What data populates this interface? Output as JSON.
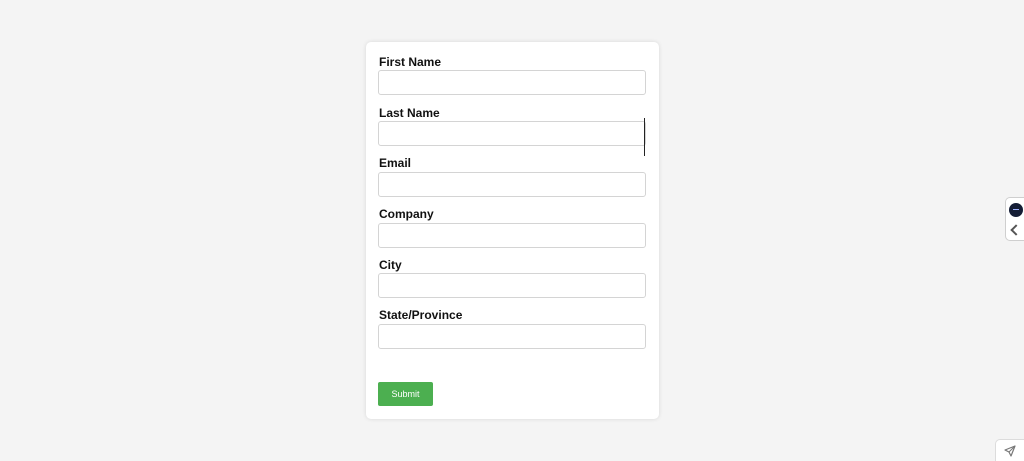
{
  "form": {
    "fields": [
      {
        "label": "First Name",
        "value": ""
      },
      {
        "label": "Last Name",
        "value": ""
      },
      {
        "label": "Email",
        "value": ""
      },
      {
        "label": "Company",
        "value": ""
      },
      {
        "label": "City",
        "value": ""
      },
      {
        "label": "State/Province",
        "value": ""
      }
    ],
    "submit_label": "Submit"
  },
  "colors": {
    "page_background": "#f4f4f4",
    "card_background": "#ffffff",
    "submit_button": "#4caf50",
    "label_text": "#111111",
    "input_border": "#d4d4d4"
  },
  "widgets": {
    "side_panel_icons": [
      "app-logo-icon",
      "chevron-left-icon"
    ],
    "corner_icon": "rocket-icon"
  }
}
